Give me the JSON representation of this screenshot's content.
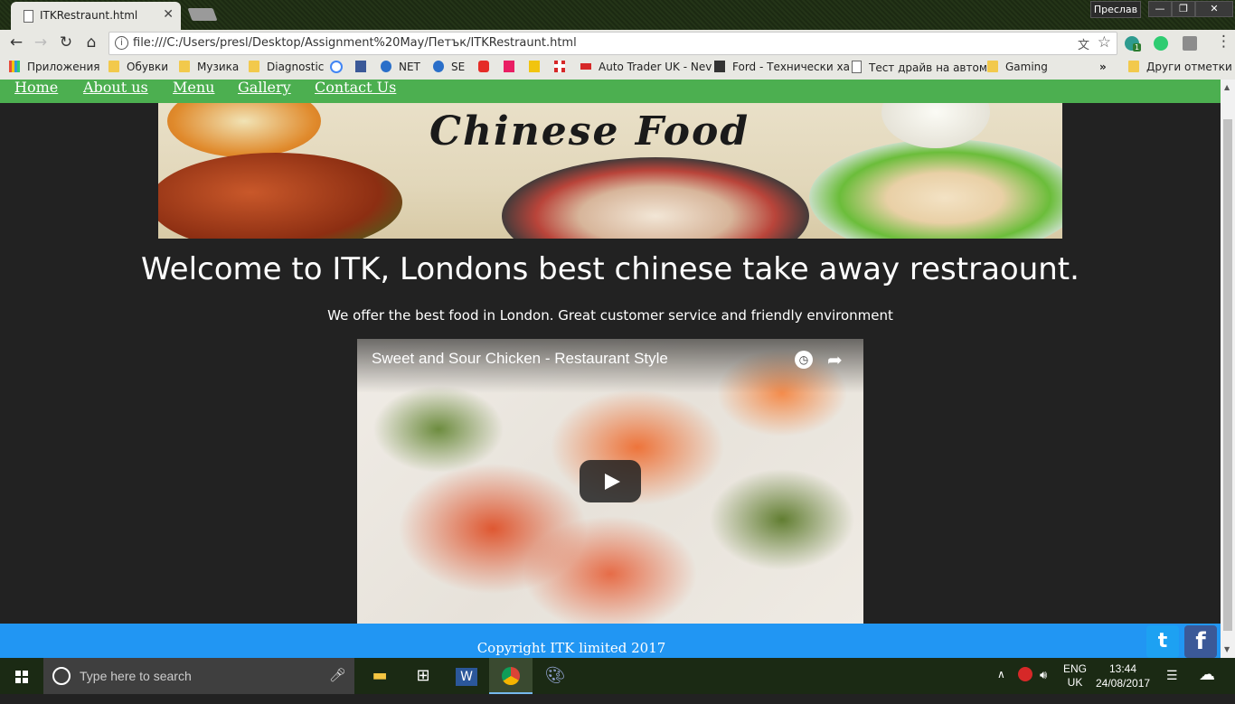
{
  "browser": {
    "tab_title": "ITKRestraunt.html",
    "user_label": "Преслав",
    "url": "file:///C:/Users/presl/Desktop/Assignment%20May/Петък/ITKRestraunt.html",
    "bookmarks": [
      "Приложения",
      "Обувки",
      "Музика",
      "Diagnostic",
      "NET",
      "SE",
      "Auto Trader UK - Nev",
      "Ford - Технически ха",
      "Тест драйв на автом",
      "Gaming"
    ],
    "other_bookmarks": "Други отметки",
    "extension_badge": "1",
    "overflow_chevron": "»"
  },
  "page": {
    "nav": [
      "Home",
      "About us",
      "Menu",
      "Gallery",
      "Contact Us"
    ],
    "banner_text": "Chinese Food",
    "heading": "Welcome to ITK, Londons best chinese take away restraount.",
    "tagline": "We offer the best food in London. Great customer service and friendly environment",
    "video_title": "Sweet and Sour Chicken - Restaurant Style",
    "footer": "Copyright ITK limited 2017",
    "social": {
      "twitter": "t",
      "facebook": "f"
    }
  },
  "taskbar": {
    "search_placeholder": "Type here to search",
    "lang_top": "ENG",
    "lang_bottom": "UK",
    "time": "13:44",
    "date": "24/08/2017"
  },
  "colors": {
    "nav_bg": "#4caf50",
    "footer_bg": "#2196f3",
    "page_bg": "#222222"
  }
}
